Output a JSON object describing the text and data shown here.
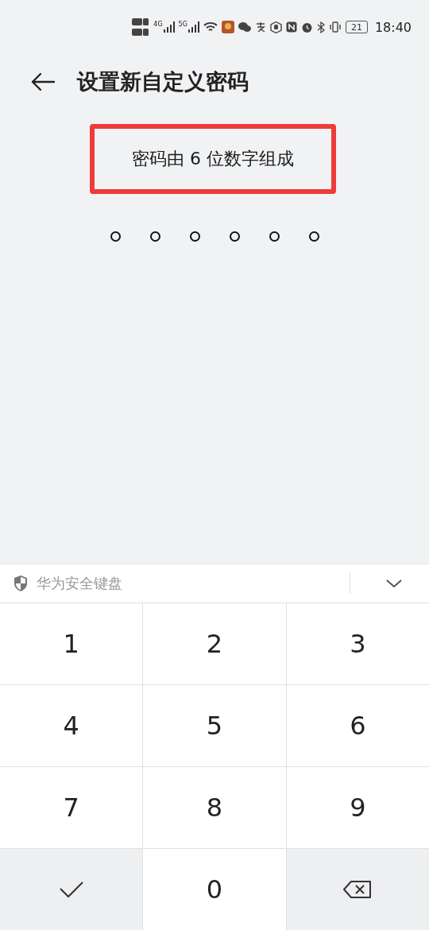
{
  "status_bar": {
    "networks": [
      "4G",
      "5G"
    ],
    "battery": "21",
    "time": "18:40"
  },
  "header": {
    "title": "设置新自定义密码"
  },
  "hint": {
    "text": "密码由 6 位数字组成",
    "highlighted": true
  },
  "pin_dots": [
    {
      "filled": false
    },
    {
      "filled": false
    },
    {
      "filled": false
    },
    {
      "filled": false
    },
    {
      "filled": false
    },
    {
      "filled": false
    }
  ],
  "keyboard": {
    "title": "华为安全键盘",
    "keys": [
      {
        "kind": "digit",
        "label": "1"
      },
      {
        "kind": "digit",
        "label": "2"
      },
      {
        "kind": "digit",
        "label": "3"
      },
      {
        "kind": "digit",
        "label": "4"
      },
      {
        "kind": "digit",
        "label": "5"
      },
      {
        "kind": "digit",
        "label": "6"
      },
      {
        "kind": "digit",
        "label": "7"
      },
      {
        "kind": "digit",
        "label": "8"
      },
      {
        "kind": "digit",
        "label": "9"
      },
      {
        "kind": "confirm"
      },
      {
        "kind": "digit",
        "label": "0"
      },
      {
        "kind": "delete"
      }
    ]
  }
}
